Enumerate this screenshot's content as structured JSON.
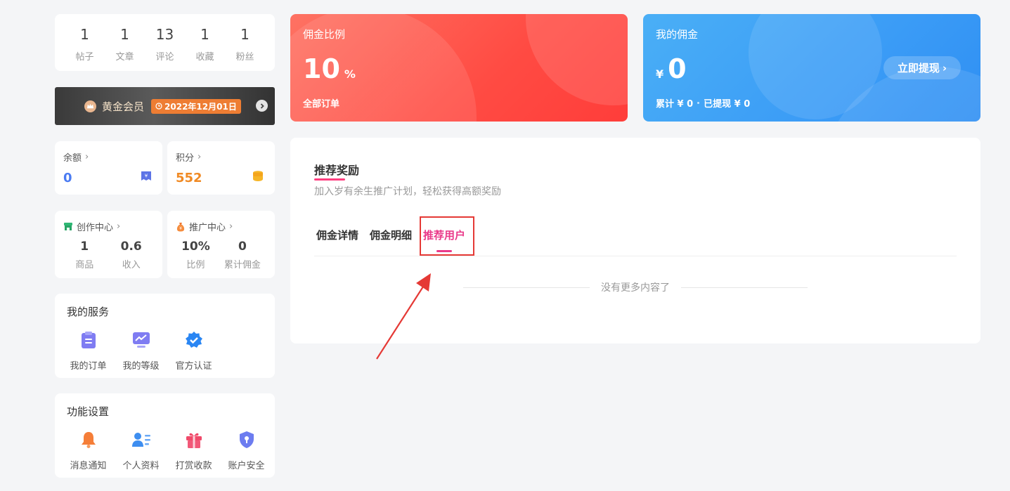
{
  "stats": [
    {
      "num": "1",
      "label": "帖子"
    },
    {
      "num": "1",
      "label": "文章"
    },
    {
      "num": "13",
      "label": "评论"
    },
    {
      "num": "1",
      "label": "收藏"
    },
    {
      "num": "1",
      "label": "粉丝"
    }
  ],
  "vip": {
    "name": "黄金会员",
    "date": "2022年12月01日"
  },
  "wallet": {
    "balance_label": "余额",
    "balance": "0",
    "points_label": "积分",
    "points": "552"
  },
  "creation": {
    "title": "创作中心",
    "cols": [
      {
        "v": "1",
        "l": "商品"
      },
      {
        "v": "0.6",
        "l": "收入"
      }
    ]
  },
  "promotion": {
    "title": "推广中心",
    "cols": [
      {
        "v": "10%",
        "l": "比例"
      },
      {
        "v": "0",
        "l": "累计佣金"
      }
    ]
  },
  "services": {
    "title": "我的服务",
    "items": [
      {
        "label": "我的订单",
        "icon": "clipboard-icon"
      },
      {
        "label": "我的等级",
        "icon": "chart-icon"
      },
      {
        "label": "官方认证",
        "icon": "verified-icon"
      }
    ]
  },
  "settings": {
    "title": "功能设置",
    "items": [
      {
        "label": "消息通知",
        "icon": "bell-icon"
      },
      {
        "label": "个人资料",
        "icon": "user-card-icon"
      },
      {
        "label": "打赏收款",
        "icon": "gift-icon"
      },
      {
        "label": "账户安全",
        "icon": "shield-icon"
      }
    ]
  },
  "commission_rate": {
    "title": "佣金比例",
    "value": "10",
    "unit": "%",
    "foot": "全部订单"
  },
  "my_commission": {
    "title": "我的佣金",
    "currency": "¥",
    "value": "0",
    "total": "累计 ¥ 0",
    "withdrawn": "已提现 ¥ 0",
    "withdraw_button": "立即提现"
  },
  "main": {
    "title": "推荐奖励",
    "subtitle": "加入岁有余生推广计划，轻松获得高额奖励",
    "tabs": [
      "佣金详情",
      "佣金明细",
      "推荐用户"
    ],
    "empty_text": "没有更多内容了"
  },
  "colors": {
    "accent_pink": "#ea3b8a",
    "red_banner": "#ff4b43",
    "blue_banner": "#3b9cf6",
    "annotation_red": "#e53935"
  }
}
